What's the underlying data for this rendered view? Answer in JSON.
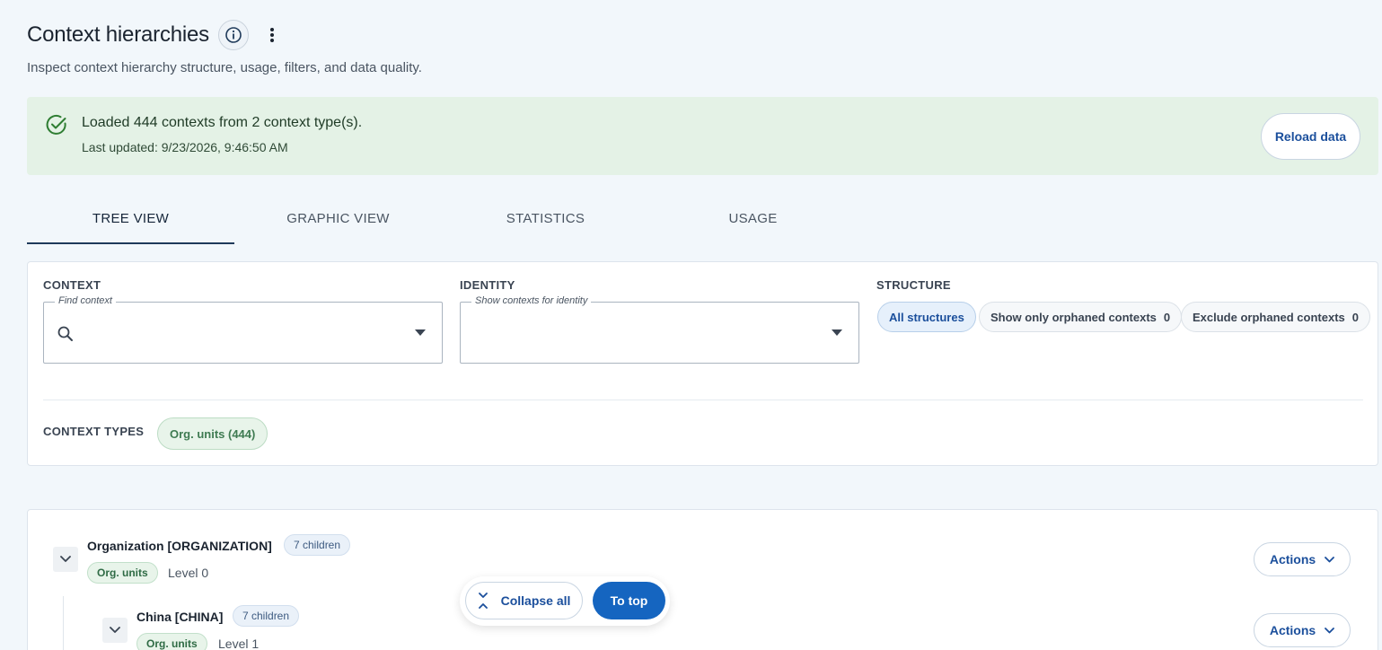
{
  "header": {
    "title": "Context hierarchies",
    "subtitle": "Inspect context hierarchy structure, usage, filters, and data quality."
  },
  "banner": {
    "message": "Loaded 444 contexts from 2 context type(s).",
    "updated": "Last updated: 9/23/2026, 9:46:50 AM",
    "reload_label": "Reload data"
  },
  "tabs": [
    {
      "label": "TREE VIEW",
      "active": true
    },
    {
      "label": "GRAPHIC VIEW",
      "active": false
    },
    {
      "label": "STATISTICS",
      "active": false
    },
    {
      "label": "USAGE",
      "active": false
    }
  ],
  "filters": {
    "context": {
      "label": "CONTEXT",
      "legend": "Find context",
      "value": ""
    },
    "identity": {
      "label": "IDENTITY",
      "legend": "Show contexts for identity",
      "value": ""
    },
    "structure": {
      "label": "STRUCTURE",
      "options": [
        {
          "label": "All structures",
          "count": "",
          "selected": true
        },
        {
          "label": "Show only orphaned contexts",
          "count": "0",
          "selected": false
        },
        {
          "label": "Exclude orphaned contexts",
          "count": "0",
          "selected": false
        }
      ]
    },
    "context_types": {
      "label": "CONTEXT TYPES",
      "chip": "Org. units (444)"
    }
  },
  "tree": {
    "nodes": [
      {
        "name": "Organization [ORGANIZATION]",
        "children": "7 children",
        "type": "Org. units",
        "level": "Level 0",
        "actions": "Actions"
      },
      {
        "name": "China [CHINA]",
        "children": "7 children",
        "type": "Org. units",
        "level": "Level 1",
        "actions": "Actions"
      }
    ]
  },
  "floating": {
    "collapse_label": "Collapse all",
    "top_label": "To top"
  },
  "colors": {
    "accent": "#1565c0",
    "success_bg": "#e4f2e6",
    "success_icon": "#2e7d32"
  }
}
